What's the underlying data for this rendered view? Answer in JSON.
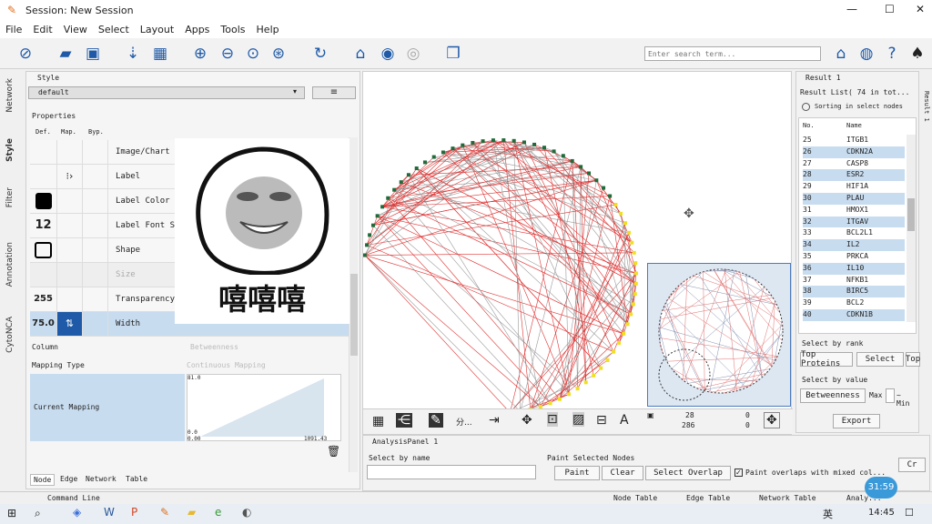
{
  "window": {
    "title": "Session: New Session",
    "min": "—",
    "max": "☐",
    "close": "✕"
  },
  "menu": [
    "File",
    "Edit",
    "View",
    "Select",
    "Layout",
    "Apps",
    "Tools",
    "Help"
  ],
  "toolbar": {
    "search_placeholder": "Enter search term..."
  },
  "side_tabs": [
    "Network",
    "Style",
    "Filter",
    "Annotation",
    "CytoNCA"
  ],
  "style_panel": {
    "header": "Style",
    "style_name": "default",
    "properties_label": "Properties",
    "col_def": "Def.",
    "col_map": "Map.",
    "col_byp": "Byp."
  },
  "properties": [
    {
      "label": "Image/Chart 1",
      "def": ""
    },
    {
      "label": "Label",
      "def": ""
    },
    {
      "label": "Label Color",
      "def": ""
    },
    {
      "label": "Label Font Size",
      "def": "12"
    },
    {
      "label": "Shape",
      "def": ""
    },
    {
      "label": "Size",
      "def": ""
    },
    {
      "label": "Transparency",
      "def": "255"
    },
    {
      "label": "Width",
      "def": "75.0"
    }
  ],
  "mapping": {
    "column_label": "Column",
    "column_value": "Betweenness",
    "type_label": "Mapping Type",
    "type_value": "Continuous Mapping",
    "current_label": "Current Mapping",
    "y_top": "81.0",
    "y_bottom": "0.0",
    "x_left": "0.00",
    "x_right": "1091.43"
  },
  "sticker": {
    "caption": "嘻嘻嘻"
  },
  "left_tabs": [
    "Node",
    "Edge",
    "Network",
    "Table"
  ],
  "net_toolbar": {
    "text_label": "分...",
    "count1": "28",
    "count2": "286",
    "count3": "0",
    "count4": "0"
  },
  "result_panel": {
    "header": "Result 1",
    "list_title": "Result List( 74 in tot...",
    "sorting": "Sorting in select nodes",
    "col_no": "No.",
    "col_name": "Name",
    "rows": [
      {
        "no": "25",
        "name": "ITGB1"
      },
      {
        "no": "26",
        "name": "CDKN2A"
      },
      {
        "no": "27",
        "name": "CASP8"
      },
      {
        "no": "28",
        "name": "ESR2"
      },
      {
        "no": "29",
        "name": "HIF1A"
      },
      {
        "no": "30",
        "name": "PLAU"
      },
      {
        "no": "31",
        "name": "HMOX1"
      },
      {
        "no": "32",
        "name": "ITGAV"
      },
      {
        "no": "33",
        "name": "BCL2L1"
      },
      {
        "no": "34",
        "name": "IL2"
      },
      {
        "no": "35",
        "name": "PRKCA"
      },
      {
        "no": "36",
        "name": "IL10"
      },
      {
        "no": "37",
        "name": "NFKB1"
      },
      {
        "no": "38",
        "name": "BIRC5"
      },
      {
        "no": "39",
        "name": "BCL2"
      },
      {
        "no": "40",
        "name": "CDKN1B"
      }
    ],
    "select_by_rank": "Select by rank",
    "top_proteins": "Top Proteins",
    "select_btn": "Select",
    "top2": "Top",
    "select_by_value": "Select by value",
    "value_col": "Betweenness",
    "max": "Max",
    "min": "~ Min",
    "export": "Export"
  },
  "result_side": "Result 1",
  "analysis": {
    "header": "AnalysisPanel 1",
    "select_by_name": "Select by name",
    "paint_selected": "Paint Selected Nodes",
    "paint": "Paint",
    "clear": "Clear",
    "select_overlap": "Select Overlap",
    "paint_overlaps": "Paint overlaps with mixed col...",
    "cr": "Cr"
  },
  "status": {
    "command_line": "Command Line",
    "tabs": [
      "Node Table",
      "Edge Table",
      "Network Table",
      "Analy..."
    ],
    "timer": "31:59"
  },
  "taskbar": {
    "ime": "英",
    "time": "14:45"
  },
  "colors": {
    "accent": "#1e5aa8",
    "selected_row": "#c8dcf0",
    "edge_red": "#e03030",
    "edge_gray": "#9a9a9a",
    "node_green": "#1f6b3a",
    "node_yellow": "#f0e020"
  }
}
